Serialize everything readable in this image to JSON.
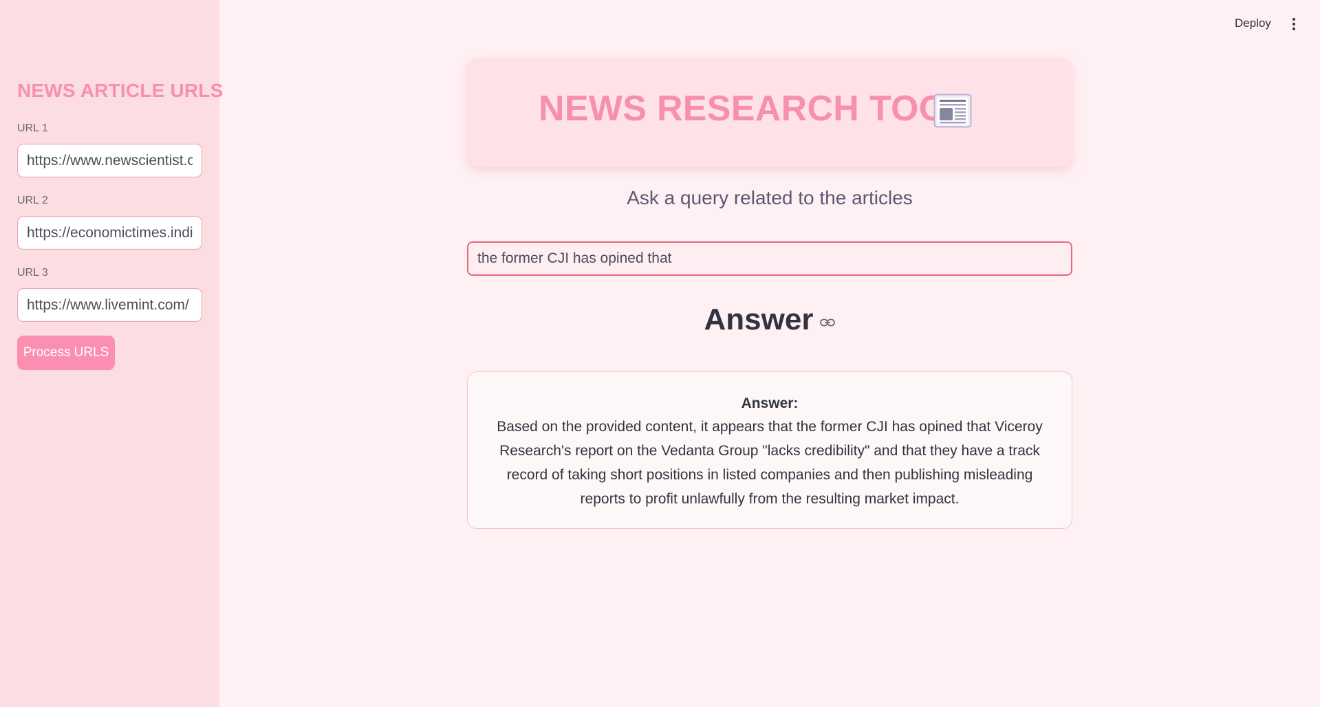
{
  "sidebar": {
    "title": "NEWS ARTICLE URLS",
    "urls": [
      {
        "label": "URL 1",
        "value": "https://www.newscientist.com/"
      },
      {
        "label": "URL 2",
        "value": "https://economictimes.indiatimes.com/"
      },
      {
        "label": "URL 3",
        "value": "https://www.livemint.com/"
      }
    ],
    "process_button": "Process URLS"
  },
  "toolbar": {
    "deploy_label": "Deploy",
    "menu_icon": "kebab-menu-icon"
  },
  "main": {
    "title": "NEWS RESEARCH TOOL",
    "title_icon": "newspaper-icon",
    "subtitle": "Ask a query related to the articles",
    "query_value": "the former CJI has opined that",
    "answer_heading": "Answer",
    "answer_heading_icon": "link-icon",
    "answer_label": "Answer:",
    "answer_text": "Based on the provided content, it appears that the former CJI has opined that Viceroy Research's report on the Vedanta Group \"lacks credibility\" and that they have a track record of taking short positions in listed companies and then publishing misleading reports to profit unlawfully from the resulting market impact."
  },
  "colors": {
    "accent_pink": "#f78fae",
    "button_pink": "#fb8fb2",
    "sidebar_bg": "#fbdde2",
    "page_bg": "#fff0f3",
    "focus_border": "#e8667f"
  }
}
